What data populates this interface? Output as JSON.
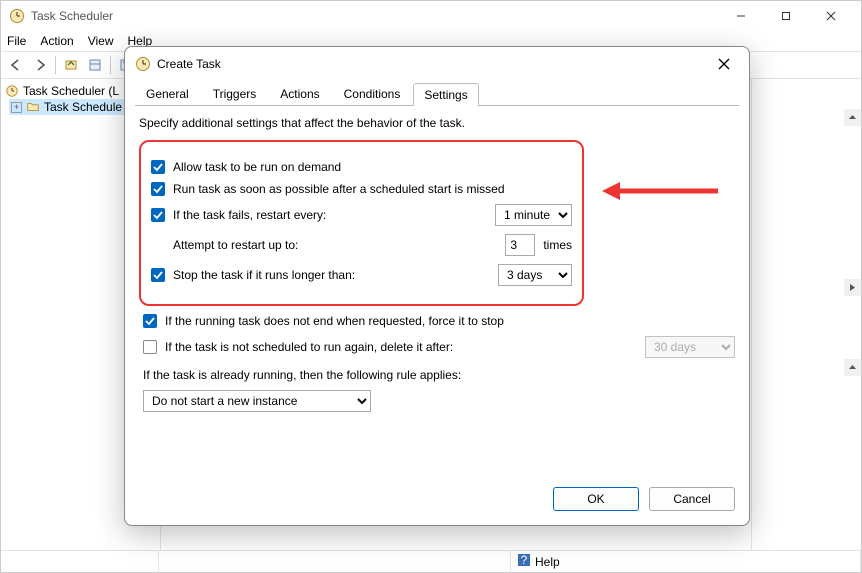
{
  "window": {
    "title": "Task Scheduler",
    "menu": [
      "File",
      "Action",
      "View",
      "Help"
    ],
    "tree": {
      "root": "Task Scheduler (L",
      "child": "Task Schedule"
    },
    "status_help": "Help"
  },
  "dialog": {
    "title": "Create Task",
    "tabs": [
      "General",
      "Triggers",
      "Actions",
      "Conditions",
      "Settings"
    ],
    "active_tab": 4,
    "intro": "Specify additional settings that affect the behavior of the task.",
    "settings": {
      "allow_on_demand": {
        "checked": true,
        "label": "Allow task to be run on demand"
      },
      "run_asap": {
        "checked": true,
        "label": "Run task as soon as possible after a scheduled start is missed"
      },
      "restart_if_fail": {
        "checked": true,
        "label": "If the task fails, restart every:",
        "value": "1 minute"
      },
      "attempt_label": "Attempt to restart up to:",
      "attempt_count": "3",
      "attempt_suffix": "times",
      "stop_longer": {
        "checked": true,
        "label": "Stop the task if it runs longer than:",
        "value": "3 days"
      },
      "force_stop": {
        "checked": true,
        "label": "If the running task does not end when requested, force it to stop"
      },
      "delete_after": {
        "checked": false,
        "label": "If the task is not scheduled to run again, delete it after:",
        "value": "30 days"
      },
      "already_running_label": "If the task is already running, then the following rule applies:",
      "already_running_value": "Do not start a new instance"
    },
    "buttons": {
      "ok": "OK",
      "cancel": "Cancel"
    }
  }
}
